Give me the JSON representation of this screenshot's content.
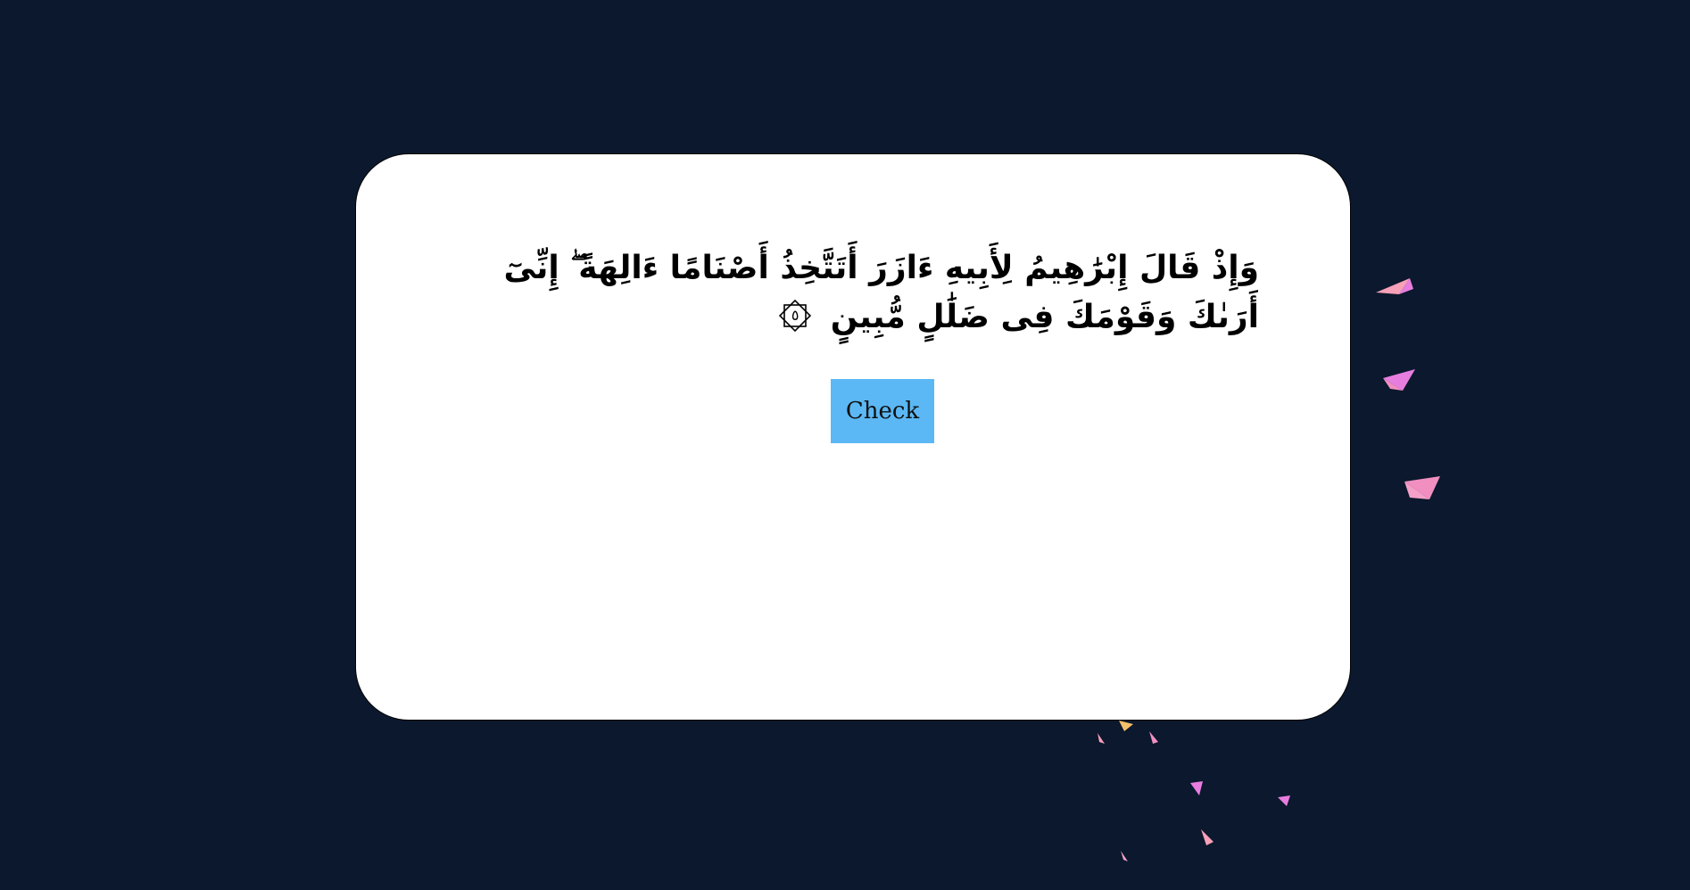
{
  "verse": {
    "line_text": "وَإِذْ قَالَ إِبْرَٰهِيمُ لِأَبِيهِ ءَازَرَ أَتَتَّخِذُ أَصْنَامًا ءَالِهَةً ۖ إِنِّىٓ أَرَىٰكَ وَقَوْمَكَ فِى ضَلَٰلٍ مُّبِينٍ",
    "ayah_number": "٥"
  },
  "actions": {
    "check_label": "Check"
  },
  "colors": {
    "background": "#0b182d",
    "card": "#ffffff",
    "button": "#5bb8f5",
    "confetti": [
      "#f08fc0",
      "#e87de0",
      "#f5c06a",
      "#f7a0b8"
    ]
  },
  "icons": {
    "ayah_marker": "ayah-end-marker-icon",
    "confetti": "confetti-piece-icon"
  }
}
